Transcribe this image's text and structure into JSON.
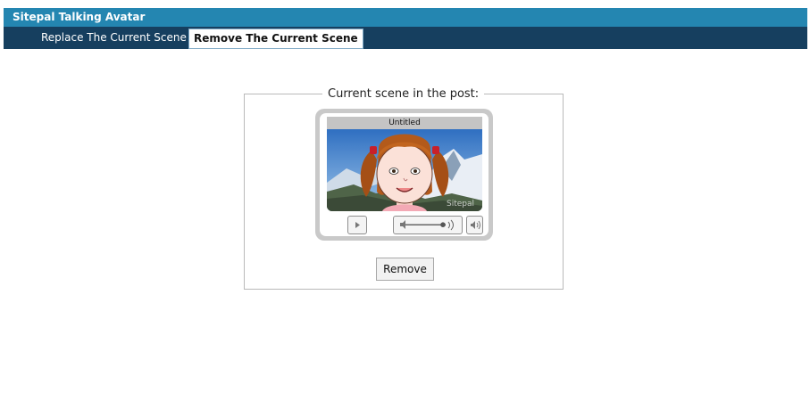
{
  "app": {
    "title": "Sitepal Talking Avatar"
  },
  "tabs": [
    {
      "label": "Replace The Current Scene"
    },
    {
      "label": "Remove The Current Scene"
    }
  ],
  "scene": {
    "legend": "Current scene in the post:",
    "player_title": "Untitled",
    "watermark": "Sitepal",
    "remove_label": "Remove"
  },
  "colors": {
    "title_bar": "#2486b1",
    "tab_bar": "#163f5f"
  },
  "icons": [
    "play-icon",
    "volume-icon",
    "mute-icon"
  ]
}
